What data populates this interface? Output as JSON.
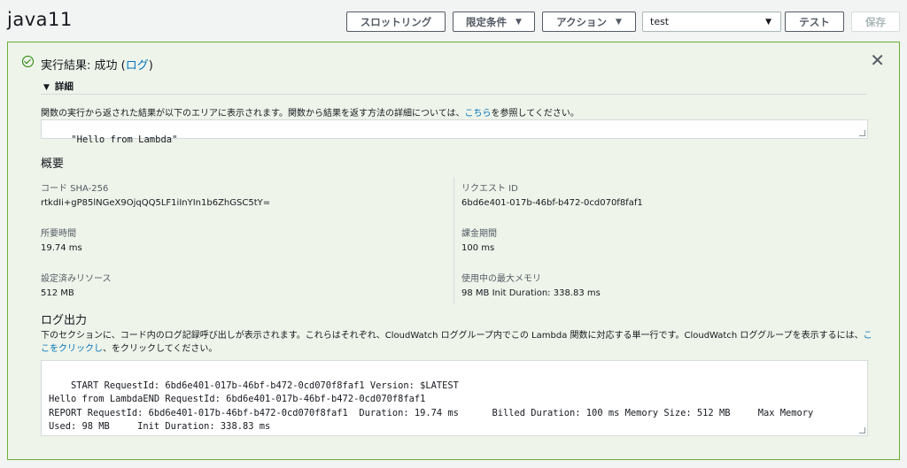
{
  "header": {
    "title": "java11",
    "throttling_label": "スロットリング",
    "qualifiers_label": "限定条件",
    "actions_label": "アクション",
    "test_event_value": "test",
    "test_label": "テスト",
    "save_label": "保存"
  },
  "result": {
    "title_prefix": "実行結果: 成功 (",
    "log_link": "ログ",
    "title_suffix": ")",
    "details_label": "詳細",
    "description_before": "関数の実行から返された結果が以下のエリアに表示されます。関数から結果を返す方法の詳細については、",
    "description_link": "こちら",
    "description_after": "を参照してください。",
    "output": "\"Hello from Lambda\""
  },
  "summary": {
    "heading": "概要",
    "code_sha_label": "コード SHA-256",
    "code_sha_value": "rtkdIi+gP85lNGeX9OjqQQ5LF1iInYIn1b6ZhGSC5tY=",
    "request_id_label": "リクエスト ID",
    "request_id_value": "6bd6e401-017b-46bf-b472-0cd070f8faf1",
    "duration_label": "所要時間",
    "duration_value": "19.74 ms",
    "billed_label": "課金期間",
    "billed_value": "100 ms",
    "resources_label": "設定済みリソース",
    "resources_value": "512 MB",
    "max_memory_label": "使用中の最大メモリ",
    "max_memory_value": "98 MB Init Duration: 338.83 ms"
  },
  "log": {
    "heading": "ログ出力",
    "description_before": "下のセクションに、コード内のログ記録呼び出しが表示されます。これらはそれぞれ、CloudWatch ロググループ内でこの Lambda 関数に対応する単一行です。CloudWatch ロググループを表示するには、",
    "description_link": "ここをクリックし",
    "description_after": "、をクリックしてください。",
    "output": "START RequestId: 6bd6e401-017b-46bf-b472-0cd070f8faf1 Version: $LATEST\nHello from LambdaEND RequestId: 6bd6e401-017b-46bf-b472-0cd070f8faf1\nREPORT RequestId: 6bd6e401-017b-46bf-b472-0cd070f8faf1  Duration: 19.74 ms      Billed Duration: 100 ms Memory Size: 512 MB     Max Memory\nUsed: 98 MB     Init Duration: 338.83 ms"
  },
  "colors": {
    "success": "#1d8102",
    "link": "#0073bb",
    "panel_border": "#6aaf35"
  }
}
